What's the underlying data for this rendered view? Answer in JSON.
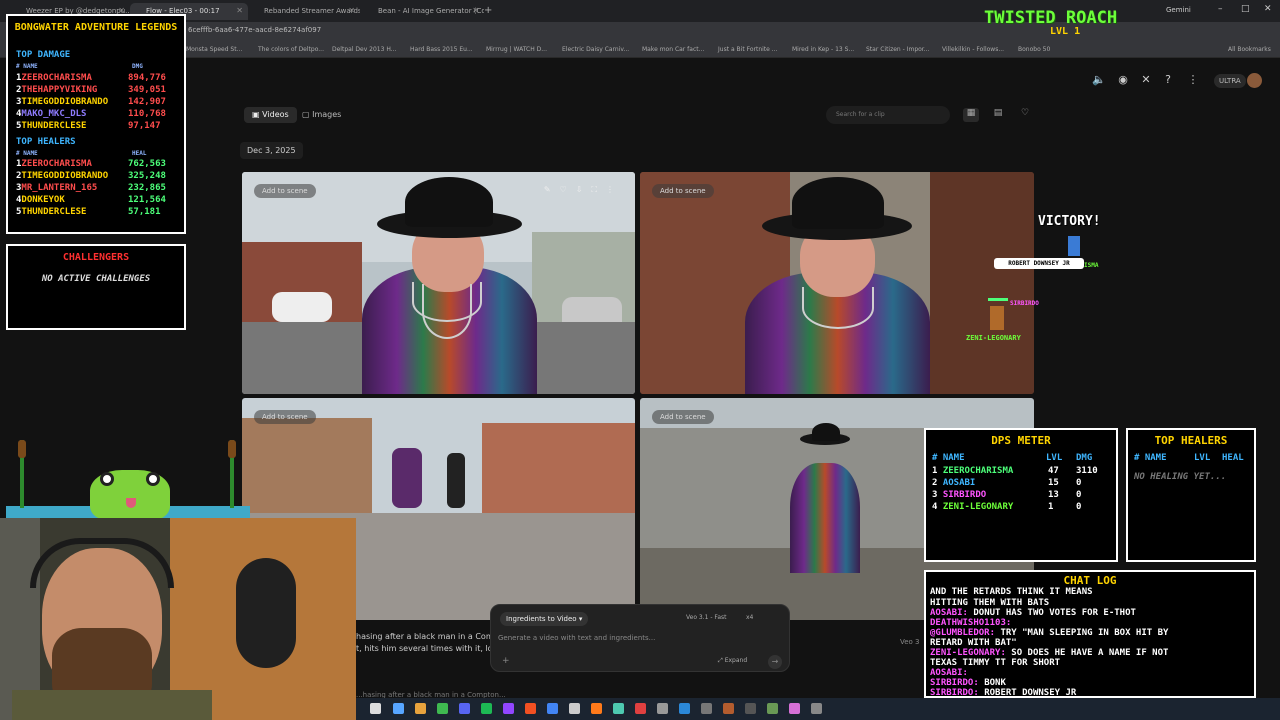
{
  "browser": {
    "tabs": [
      {
        "label": "Weezer EP by @dedgetonpu..."
      },
      {
        "label": "Flow - Elec03 - 00:17"
      },
      {
        "label": "Rebanded Streamer Awards"
      },
      {
        "label": "Bean - AI Image Generator (Co..."
      }
    ],
    "url": "6cefffb-6aa6-477e-aacd-8e6274af097",
    "profile_label": "Gemini",
    "bookmarks": [
      "Monsta Speed St...",
      "The colors of Deltpo...",
      "Deltpal Dev 2013 H...",
      "Hard Bass 2015 Eu...",
      "Mirrrug | WATCH D...",
      "Electric Daisy Carniv...",
      "Make mon Car fact...",
      "Just a Bit Fortnite ...",
      "Mired in Kep - 13 S...",
      "Star Citizen - Impor...",
      "Villekilkin - Follows...",
      "Bonobo 50",
      "All Bookmarks"
    ]
  },
  "flow": {
    "ultra_label": "ULTRA",
    "tabs": [
      "Videos",
      "Images"
    ],
    "search_placeholder": "Search for a clip",
    "date_label": "Dec 3, 2025",
    "add_to_scene": "Add to scene",
    "caption_line1": "hasing after a black man in a Compto",
    "caption_line2": "t, hits him several times with it, looks",
    "caption_bottom": "...hasing after a black man in a Compton...",
    "veo_label": "Veo 3",
    "prompt": {
      "mode": "Ingredients to Video",
      "model": "Veo 3.1 - Fast",
      "count": "x4",
      "placeholder": "Generate a video with text and ingredients...",
      "expand": "Expand"
    }
  },
  "overlay": {
    "game_title": "BONGWATER ADVENTURE LEGENDS",
    "top_damage_title": "TOP DAMAGE",
    "top_healers_title": "TOP HEALERS",
    "col_name": "# NAME",
    "col_dmg": "DMG",
    "col_heal": "HEAL",
    "top_damage": [
      {
        "rank": "1",
        "name": "ZEEROCHARISMA",
        "value": "894,776"
      },
      {
        "rank": "2",
        "name": "THEHAPPYVIKING",
        "value": "349,051"
      },
      {
        "rank": "3",
        "name": "TIMEGODDIOBRANDO",
        "value": "142,907"
      },
      {
        "rank": "4",
        "name": "MAKO_MKC_DLS",
        "value": "110,768"
      },
      {
        "rank": "5",
        "name": "THUNDERCLESE",
        "value": "97,147"
      }
    ],
    "top_healers": [
      {
        "rank": "1",
        "name": "ZEEROCHARISMA",
        "value": "762,563"
      },
      {
        "rank": "2",
        "name": "TIMEGODDIOBRANDO",
        "value": "325,248"
      },
      {
        "rank": "3",
        "name": "MR_LANTERN_165",
        "value": "232,865"
      },
      {
        "rank": "4",
        "name": "DONKEYOK",
        "value": "121,564"
      },
      {
        "rank": "5",
        "name": "THUNDERCLESE",
        "value": "57,181"
      }
    ],
    "challengers_title": "CHALLENGERS",
    "challengers_empty": "NO ACTIVE CHALLENGES",
    "boss_name": "TWISTED ROACH",
    "boss_level": "LVL 1",
    "victory": "VICTORY!",
    "boss_tag": "ROBERT DOWNSEY JR",
    "player_tags": [
      "ISMA",
      "SIRBIRDO",
      "ZENI-LEGONARY"
    ],
    "dps_meter": {
      "title": "DPS METER",
      "col_name": "# NAME",
      "col_lvl": "LVL",
      "col_dmg": "DMG",
      "rows": [
        {
          "rank": "1",
          "name": "ZEEROCHARISMA",
          "lvl": "47",
          "dmg": "3110"
        },
        {
          "rank": "2",
          "name": "AOSABI",
          "lvl": "15",
          "dmg": "0"
        },
        {
          "rank": "3",
          "name": "SIRBIRDO",
          "lvl": "13",
          "dmg": "0"
        },
        {
          "rank": "4",
          "name": "ZENI-LEGONARY",
          "lvl": "1",
          "dmg": "0"
        }
      ]
    },
    "healers_meter": {
      "title": "TOP HEALERS",
      "col_name": "# NAME",
      "col_lvl": "LVL",
      "col_heal": "HEAL",
      "empty": "NO HEALING YET..."
    },
    "chat_log": {
      "title": "CHAT LOG",
      "lines": [
        {
          "name": "",
          "text": "AND THE RETARDS THINK IT MEANS"
        },
        {
          "name": "",
          "text": "HITTING THEM WITH BATS"
        },
        {
          "name": "AOSABI:",
          "text": "DONUT HAS TWO VOTES FOR E-THOT"
        },
        {
          "name": "DEATHWISHO1103:",
          "text": ""
        },
        {
          "name": "@GLUMBLEDOR:",
          "text": "TRY \"MAN SLEEPING IN BOX HIT BY"
        },
        {
          "name": "",
          "text": "RETARD WITH BAT\""
        },
        {
          "name": "ZENI-LEGONARY:",
          "text": "SO DOES HE HAVE A NAME IF NOT"
        },
        {
          "name": "",
          "text": "TEXAS TIMMY TT FOR SHORT"
        },
        {
          "name": "AOSABI:",
          "text": ""
        },
        {
          "name": "SIRBIRDO:",
          "text": "BONK"
        },
        {
          "name": "SIRBIRDO:",
          "text": "ROBERT DOWNSEY JR"
        }
      ]
    }
  },
  "colors": {
    "overlay_yellow": "#ffd400",
    "overlay_blue": "#3fb6ff",
    "overlay_red": "#ff4d4d",
    "overlay_green": "#4dff7a",
    "overlay_magenta": "#ff55ff",
    "boss_green": "#6dff3a"
  }
}
